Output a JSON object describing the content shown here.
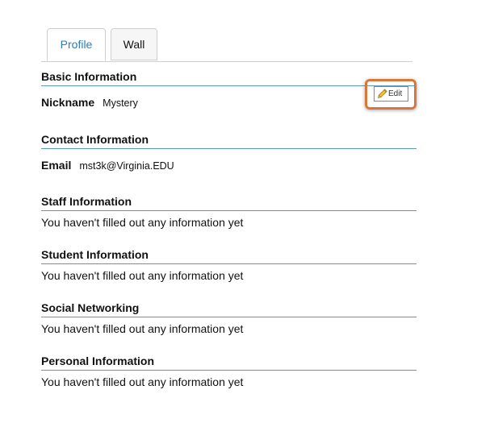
{
  "tabs": [
    {
      "label": "Profile",
      "active": true
    },
    {
      "label": "Wall",
      "active": false
    }
  ],
  "basic": {
    "title": "Basic Information",
    "nickname_label": "Nickname",
    "nickname_value": "Mystery",
    "edit_label": "Edit",
    "edit_icon": "pencil-icon"
  },
  "contact": {
    "title": "Contact Information",
    "email_label": "Email",
    "email_value": "mst3k@Virginia.EDU"
  },
  "staff": {
    "title": "Staff Information",
    "text": "You haven't filled out any information yet"
  },
  "student": {
    "title": "Student Information",
    "text": "You haven't filled out any information yet"
  },
  "social": {
    "title": "Social Networking",
    "text": "You haven't filled out any information yet"
  },
  "personal": {
    "title": "Personal Information",
    "text": "You haven't filled out any information yet"
  },
  "colors": {
    "accent": "#2a7fb5",
    "rule": "#5b97bd",
    "highlight": "#d9773a"
  }
}
